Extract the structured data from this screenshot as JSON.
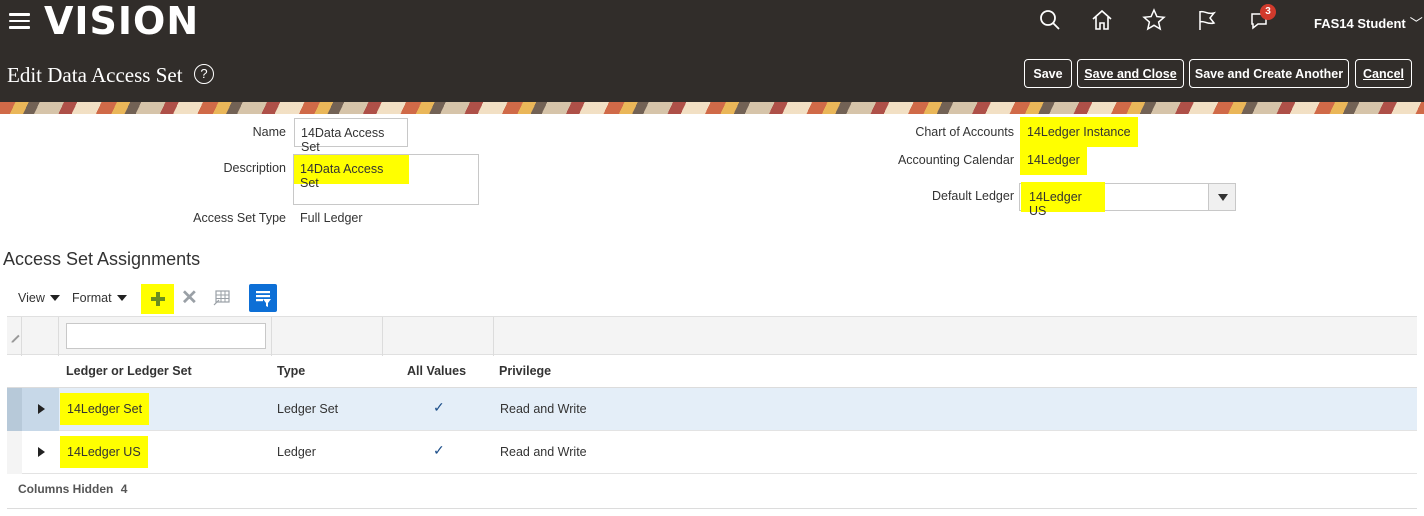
{
  "app": {
    "brand": "VISION",
    "user_name": "FAS14 Student",
    "notification_count": "3"
  },
  "header_icons": [
    "search-icon",
    "home-icon",
    "star-icon",
    "flag-icon",
    "notifications-icon"
  ],
  "page": {
    "title": "Edit Data Access Set",
    "help_symbol": "?",
    "buttons": {
      "save": "Save",
      "save_and_close": "Save and Close",
      "save_and_create": "Save and Create Another",
      "cancel": "Cancel"
    }
  },
  "form": {
    "name": {
      "label": "Name",
      "value": "14Data Access Set"
    },
    "description": {
      "label": "Description",
      "value": "14Data Access Set"
    },
    "access_set_type": {
      "label": "Access Set Type",
      "value": "Full Ledger"
    },
    "chart_of_accounts": {
      "label": "Chart of Accounts",
      "value": "14Ledger Instance"
    },
    "accounting_calendar": {
      "label": "Accounting Calendar",
      "value": "14Ledger"
    },
    "default_ledger": {
      "label": "Default Ledger",
      "value": "14Ledger US"
    }
  },
  "section": {
    "title": "Access Set Assignments",
    "toolbar": {
      "view": "View",
      "format": "Format"
    }
  },
  "table": {
    "headers": {
      "ledger": "Ledger or Ledger Set",
      "type": "Type",
      "all_values": "All Values",
      "privilege": "Privilege"
    },
    "rows": [
      {
        "ledger": "14Ledger Set",
        "type": "Ledger Set",
        "all_values": "✓",
        "privilege": "Read and Write"
      },
      {
        "ledger": "14Ledger US",
        "type": "Ledger",
        "all_values": "✓",
        "privilege": "Read and Write"
      }
    ],
    "footer": {
      "columns_hidden_label": "Columns Hidden",
      "columns_hidden_count": "4"
    }
  },
  "colors": {
    "header_bg": "#312d2a",
    "highlight": "#ffff00",
    "selected_row": "#e4eef8",
    "qbe_blue": "#0d6fd6"
  }
}
